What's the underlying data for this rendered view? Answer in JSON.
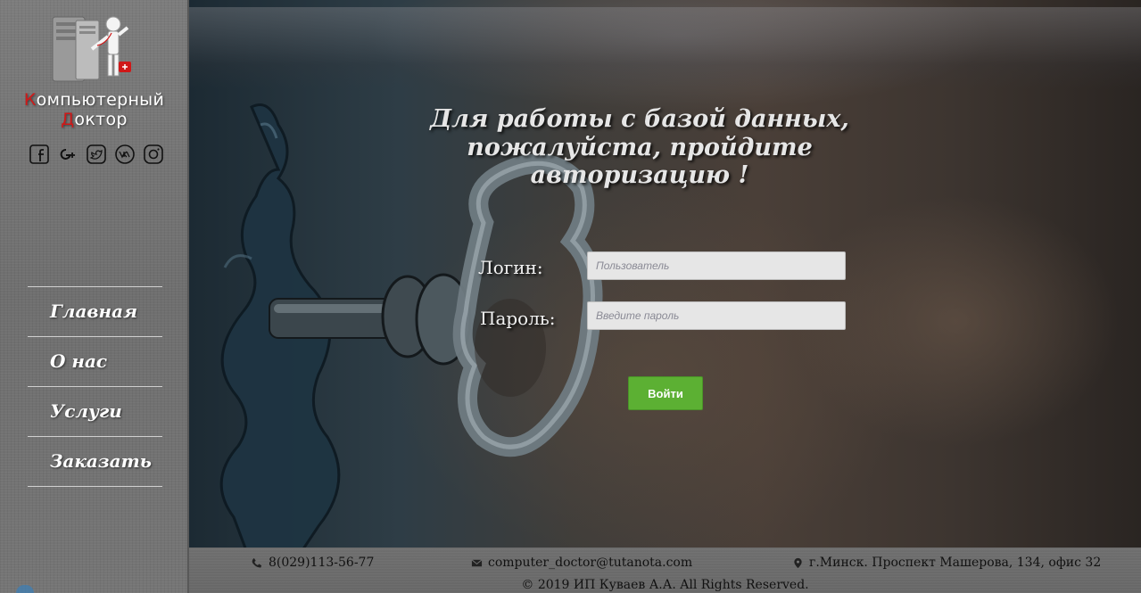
{
  "brand": {
    "line1_first": "К",
    "line1_rest": "омпьютерный",
    "line2_first": "Д",
    "line2_rest": "октор"
  },
  "socials": [
    "facebook-icon",
    "google-plus-icon",
    "twitter-icon",
    "vk-icon",
    "instagram-icon"
  ],
  "nav": {
    "items": [
      {
        "label": "Главная"
      },
      {
        "label": "О нас"
      },
      {
        "label": "Услуги"
      },
      {
        "label": "Заказать"
      }
    ]
  },
  "main": {
    "headline_line1": "Для работы с базой данных,",
    "headline_line2": "пожалуйста, пройдите авторизацию !"
  },
  "form": {
    "login_label": "Логин:",
    "login_placeholder": "Пользователь",
    "login_value": "",
    "password_label": "Пароль:",
    "password_placeholder": "Введите пароль",
    "password_value": "",
    "submit_label": "Войти"
  },
  "footer": {
    "phone": "8(029)113-56-77",
    "email": "computer_doctor@tutanota.com",
    "address": "г.Минск. Проспект Машерова, 134, офис 32",
    "copyright": "© 2019 ИП Куваев А.А. All Rights Reserved."
  },
  "colors": {
    "accent_red": "#d01818",
    "button_green": "#5cb033"
  }
}
